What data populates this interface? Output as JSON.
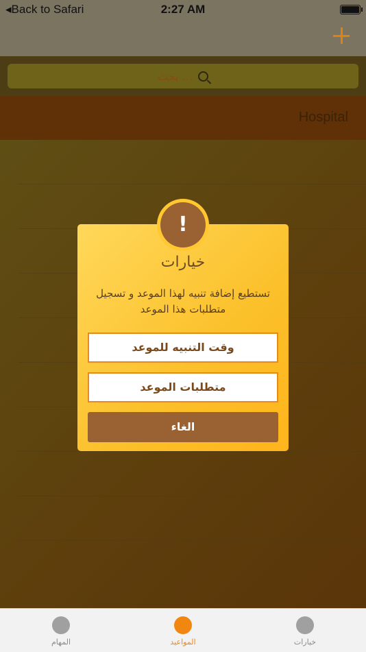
{
  "status_bar": {
    "back_label": "Back to Safari",
    "time": "2:27 AM"
  },
  "search": {
    "placeholder": "بحث ..."
  },
  "list": {
    "header": "Hospital"
  },
  "dialog": {
    "icon": "!",
    "title": "خيارات",
    "message": "تستطيع إضافة تنبيه لهذا الموعد و تسجيل متطلبات هذا الموعد",
    "option_alert_time": "وقت التنبيه للموعد",
    "option_requirements": "متطلبات الموعد",
    "cancel": "الغاء"
  },
  "tabs": [
    {
      "label": "المهام",
      "icon": "circle-icon"
    },
    {
      "label": "المواعيد",
      "icon": "circle-icon",
      "active": true
    },
    {
      "label": "خيارات",
      "icon": "circle-icon"
    }
  ],
  "colors": {
    "accent": "#f18611",
    "dialog_bg": "#ffc833",
    "brown": "#9a6233"
  }
}
